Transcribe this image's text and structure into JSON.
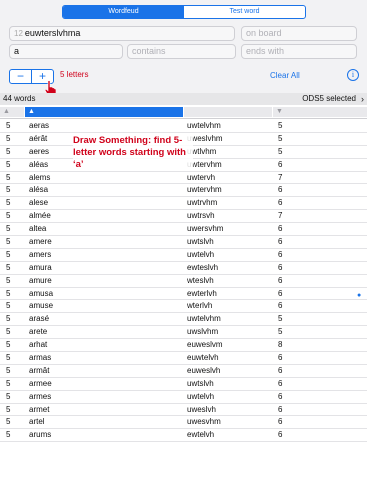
{
  "segmented": {
    "tabs": [
      "Wordfeud",
      "Test word"
    ],
    "active": 0
  },
  "inputs": {
    "letters": {
      "count": "12",
      "value": "euwterslvhma"
    },
    "on_board": {
      "placeholder": "on board"
    },
    "word": {
      "value": "a"
    },
    "contains": {
      "placeholder": "contains"
    },
    "ends_with": {
      "placeholder": "ends with"
    }
  },
  "stepper": {
    "minus": "−",
    "plus": "+"
  },
  "length_label": "5 letters",
  "clear_all": "Clear All",
  "info_icon": "i",
  "status": {
    "word_count": "44 words",
    "dictionary": "ODS5 selected",
    "chevron": "›"
  },
  "annotation": "Draw Something: find 5-letter words starting with ‘a’",
  "colors": {
    "accent": "#1a73e8",
    "alert": "#d0021b"
  },
  "rows": [
    {
      "len": "5",
      "word": "aeras",
      "alpha": "uwtelvhm",
      "score": "5"
    },
    {
      "len": "5",
      "word": "aérât",
      "alpha": "uweslvhm",
      "score": "5"
    },
    {
      "len": "5",
      "word": "aeres",
      "alpha": "uwtlvhm",
      "score": "5"
    },
    {
      "len": "5",
      "word": "aléas",
      "alpha": "uwtervhm",
      "score": "6"
    },
    {
      "len": "5",
      "word": "alems",
      "alpha": "uwtervh",
      "score": "7"
    },
    {
      "len": "5",
      "word": "alésa",
      "alpha": "uwtervhm",
      "score": "6"
    },
    {
      "len": "5",
      "word": "alese",
      "alpha": "uwtrvhm",
      "score": "6"
    },
    {
      "len": "5",
      "word": "almée",
      "alpha": "uwtrsvh",
      "score": "7"
    },
    {
      "len": "5",
      "word": "altea",
      "alpha": "uwersvhm",
      "score": "6"
    },
    {
      "len": "5",
      "word": "amere",
      "alpha": "uwtslvh",
      "score": "6"
    },
    {
      "len": "5",
      "word": "amers",
      "alpha": "uwtelvh",
      "score": "6"
    },
    {
      "len": "5",
      "word": "amura",
      "alpha": "ewteslvh",
      "score": "6"
    },
    {
      "len": "5",
      "word": "amure",
      "alpha": "wteslvh",
      "score": "6"
    },
    {
      "len": "5",
      "word": "amusa",
      "alpha": "ewterlvh",
      "score": "6"
    },
    {
      "len": "5",
      "word": "amuse",
      "alpha": "wterlvh",
      "score": "6"
    },
    {
      "len": "5",
      "word": "arasé",
      "alpha": "uwtelvhm",
      "score": "5"
    },
    {
      "len": "5",
      "word": "arete",
      "alpha": "uwslvhm",
      "score": "5"
    },
    {
      "len": "5",
      "word": "arhat",
      "alpha": "euweslvm",
      "score": "8"
    },
    {
      "len": "5",
      "word": "armas",
      "alpha": "euwtelvh",
      "score": "6"
    },
    {
      "len": "5",
      "word": "armât",
      "alpha": "euweslvh",
      "score": "6"
    },
    {
      "len": "5",
      "word": "armee",
      "alpha": "uwtslvh",
      "score": "6"
    },
    {
      "len": "5",
      "word": "armes",
      "alpha": "uwtelvh",
      "score": "6"
    },
    {
      "len": "5",
      "word": "armet",
      "alpha": "uweslvh",
      "score": "6"
    },
    {
      "len": "5",
      "word": "artel",
      "alpha": "uwesvhm",
      "score": "6"
    },
    {
      "len": "5",
      "word": "arums",
      "alpha": "ewtelvh",
      "score": "6"
    }
  ]
}
